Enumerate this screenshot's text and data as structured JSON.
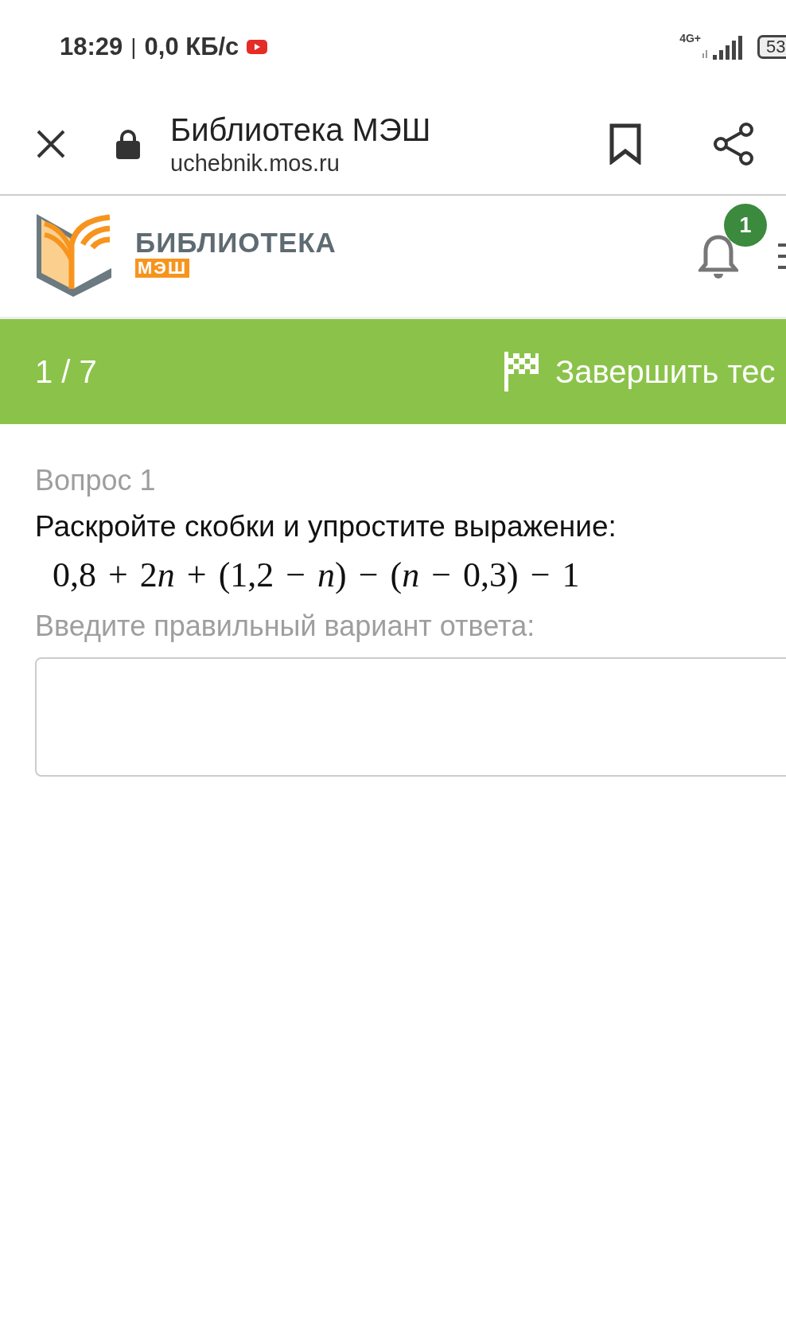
{
  "status_bar": {
    "time": "18:29",
    "separator": "|",
    "speed": "0,0 КБ/с",
    "network": "4G+",
    "battery": "53"
  },
  "browser": {
    "title": "Библиотека МЭШ",
    "url": "uchebnik.mos.ru"
  },
  "site_header": {
    "logo_title": "БИБЛИОТЕКА",
    "logo_subtitle": "МЭШ",
    "notifications": "1"
  },
  "test_bar": {
    "progress": "1 / 7",
    "finish_label": "Завершить тес"
  },
  "question": {
    "number": "Вопрос 1",
    "text": "Раскройте скобки и упростите выражение:",
    "expression": [
      {
        "kind": "number",
        "text": "0,8 + 2"
      },
      {
        "kind": "variable",
        "text": "n"
      },
      {
        "kind": "number",
        "text": " + (1,2 − "
      },
      {
        "kind": "variable",
        "text": "n"
      },
      {
        "kind": "number",
        "text": ") − ("
      },
      {
        "kind": "variable",
        "text": "n"
      },
      {
        "kind": "number",
        "text": " − 0,3) − 1"
      }
    ],
    "prompt": "Введите правильный вариант ответа:"
  }
}
